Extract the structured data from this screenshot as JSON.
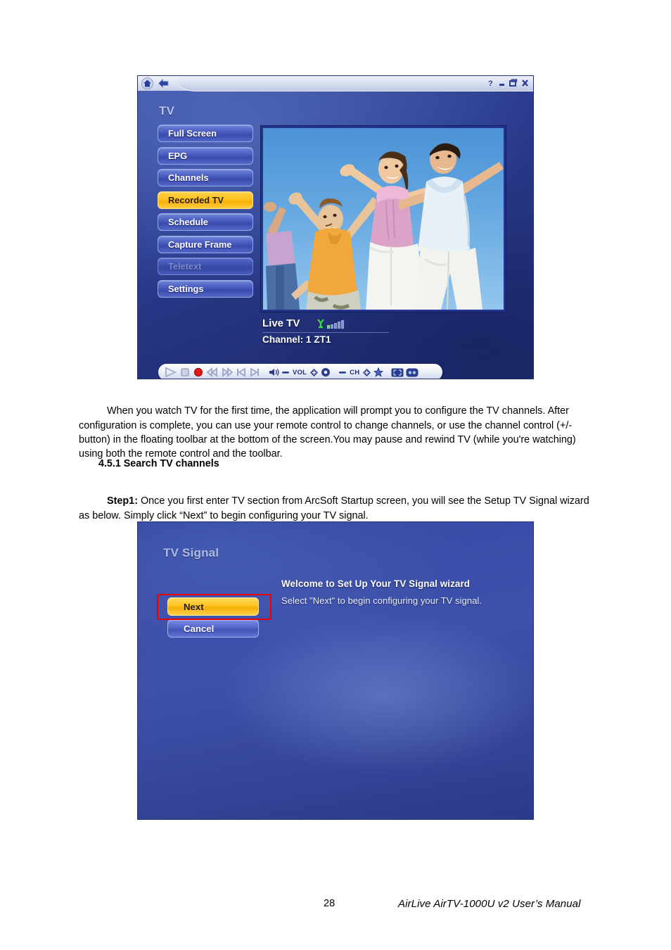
{
  "document": {
    "paragraph1": "When you watch TV for the first time, the application will prompt you to configure the TV channels. After configuration is complete, you can use your remote control to change channels, or use the channel control (+/- button) in the floating toolbar at the bottom of the screen.You may pause and rewind TV (while you're watching) using both the remote control and the toolbar.",
    "section_heading": "4.5.1 Search TV channels",
    "step_label": "Step1:",
    "step_text": " Once you first enter TV section from ArcSoft Startup screen, you will see the Setup TV Signal wizard as below. Simply click “Next” to begin configuring your TV signal."
  },
  "footer": {
    "page_number": "28",
    "manual_title": "AirLive AirTV-1000U v2 User’s Manual"
  },
  "tv_app": {
    "window_title": "TV",
    "nav_icons": [
      "home-icon",
      "back-arrow-icon"
    ],
    "window_buttons": [
      "help-icon",
      "minimize-icon",
      "restore-icon",
      "close-icon"
    ],
    "sidebar": {
      "items": [
        {
          "label": "Full Screen",
          "state": "normal"
        },
        {
          "label": "EPG",
          "state": "normal"
        },
        {
          "label": "Channels",
          "state": "normal"
        },
        {
          "label": "Recorded TV",
          "state": "selected"
        },
        {
          "label": "Schedule",
          "state": "normal"
        },
        {
          "label": "Capture Frame",
          "state": "normal"
        },
        {
          "label": "Teletext",
          "state": "disabled"
        },
        {
          "label": "Settings",
          "state": "normal"
        }
      ]
    },
    "status": {
      "mode": "Live TV",
      "channel": "Channel: 1 ZT1",
      "signal_icon": "antenna-icon",
      "signal_bars": 5,
      "signal_active_bars": 2
    },
    "toolbar": {
      "vol_label": "VOL",
      "ch_label": "CH",
      "buttons": [
        "play-icon",
        "stop-icon",
        "record-icon",
        "rewind-icon",
        "fast-forward-icon",
        "previous-track-icon",
        "next-track-icon",
        "speaker-icon",
        "volume-down-icon",
        "volume-up-icon",
        "mute-icon",
        "channel-down-icon",
        "channel-up-icon",
        "favorite-star-icon",
        "fullscreen-icon",
        "widescreen-icon"
      ]
    },
    "video": {
      "alt": "four people jumping against a blue sky"
    }
  },
  "wizard": {
    "title": "TV Signal",
    "welcome_heading": "Welcome to Set Up Your TV Signal wizard",
    "welcome_text": "Select \"Next\" to begin configuring your TV signal.",
    "next_label": "Next",
    "cancel_label": "Cancel",
    "highlight_color": "#ee0000"
  },
  "colors": {
    "accent_yellow": "#ffc526",
    "app_blue": "#3a4da8",
    "sidebar_blue": "#4a5dc0",
    "text_light": "#aebce9"
  }
}
